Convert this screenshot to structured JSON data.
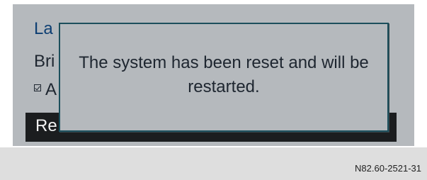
{
  "screen": {
    "menu": {
      "title": "La",
      "brightness_label": "Bri",
      "checkbox_label": "A",
      "checkbox_checked": true,
      "reset_label": "Re"
    },
    "dialog": {
      "message": "The system has been reset and will be restarted."
    }
  },
  "footer": {
    "figure_code": "N82.60-2521-31"
  }
}
